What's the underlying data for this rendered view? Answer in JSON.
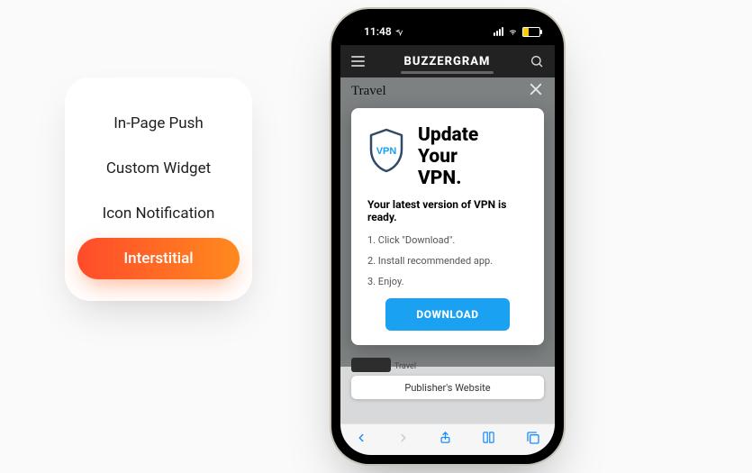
{
  "nav": {
    "items": [
      {
        "label": "In-Page Push",
        "active": false
      },
      {
        "label": "Custom Widget",
        "active": false
      },
      {
        "label": "Icon Notification",
        "active": false
      },
      {
        "label": "Interstitial",
        "active": true
      }
    ]
  },
  "phone": {
    "status": {
      "time": "11:48"
    },
    "app": {
      "brand": "BUZZERGRAM",
      "section": "Travel",
      "thumb_category": "Travel"
    },
    "interstitial": {
      "icon_label": "VPN",
      "title_line1": "Update",
      "title_line2": "Your",
      "title_line3": "VPN.",
      "subtitle": "Your latest version of VPN is ready.",
      "steps": [
        "1. Click \"Download\".",
        "2. Install recommended app.",
        "3. Enjoy."
      ],
      "cta": "DOWNLOAD"
    },
    "addressbar": "Publisher's Website"
  }
}
